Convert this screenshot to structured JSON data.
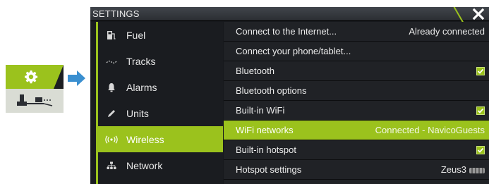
{
  "window": {
    "title": "SETTINGS"
  },
  "menu": [
    {
      "label": "Fuel",
      "icon": "fuel-pump-icon"
    },
    {
      "label": "Tracks",
      "icon": "tracks-icon"
    },
    {
      "label": "Alarms",
      "icon": "bell-icon"
    },
    {
      "label": "Units",
      "icon": "pencil-icon"
    },
    {
      "label": "Wireless",
      "icon": "wireless-icon",
      "active": true
    },
    {
      "label": "Network",
      "icon": "network-icon"
    }
  ],
  "rows": [
    {
      "label": "Connect to the Internet...",
      "value": "Already connected"
    },
    {
      "label": "Connect your phone/tablet...",
      "value": ""
    },
    {
      "label": "Bluetooth",
      "checked": true
    },
    {
      "label": "Bluetooth options",
      "value": ""
    },
    {
      "label": "Built-in WiFi",
      "checked": true
    },
    {
      "label": "WiFi networks",
      "value": "Connected - NavicoGuests",
      "active": true
    },
    {
      "label": "Built-in hotspot",
      "checked": true
    },
    {
      "label": "Hotspot settings",
      "value": "Zeus3"
    }
  ],
  "colors": {
    "accent": "#9bc21d",
    "background": "#16181c"
  }
}
